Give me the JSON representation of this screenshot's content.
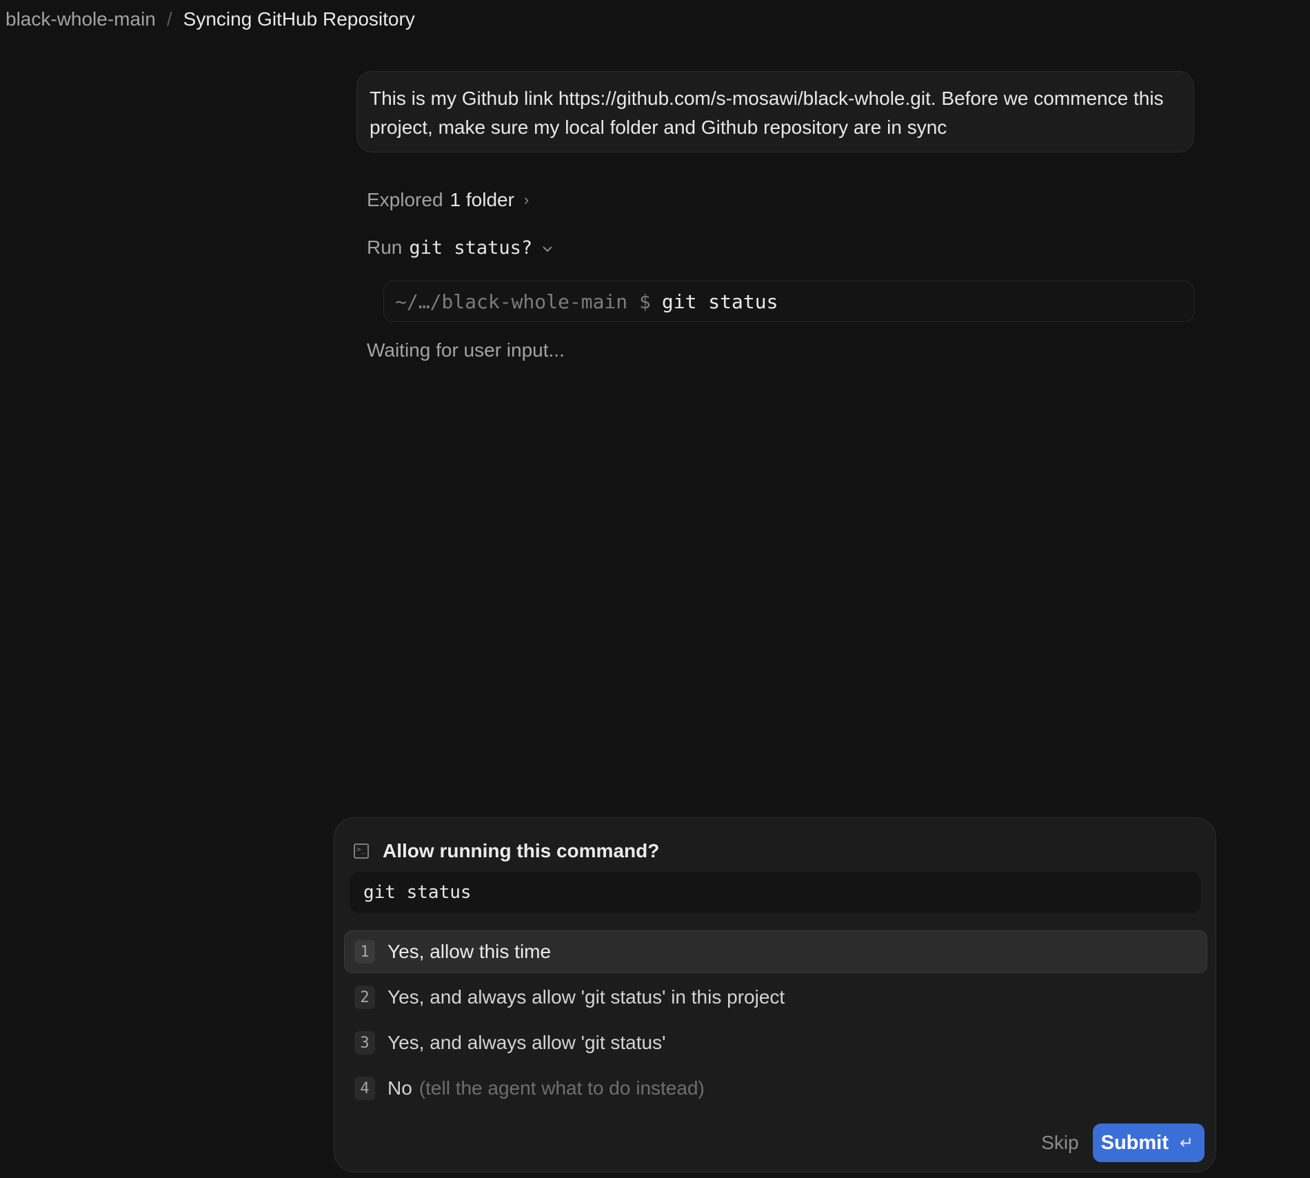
{
  "breadcrumb": {
    "project": "black-whole-main",
    "separator": "/",
    "title": "Syncing GitHub Repository"
  },
  "user_message": {
    "text": "This is my Github link https://github.com/s-mosawi/black-whole.git. Before we commence this project, make sure my local folder and Github repository are in sync"
  },
  "activity": {
    "explored_label": "Explored",
    "explored_count": "1 folder",
    "run_label": "Run",
    "run_command": "git status?",
    "terminal_prompt": "~/…/black-whole-main $",
    "terminal_command": "git status",
    "waiting_text": "Waiting for user input..."
  },
  "permission": {
    "title": "Allow running this command?",
    "icon": "terminal-icon",
    "command": "git status",
    "options": [
      {
        "num": "1",
        "label": "Yes, allow this time",
        "hint": "",
        "selected": true
      },
      {
        "num": "2",
        "label": "Yes, and always allow 'git status' in this project",
        "hint": ""
      },
      {
        "num": "3",
        "label": "Yes, and always allow 'git status'",
        "hint": ""
      },
      {
        "num": "4",
        "label": "No",
        "hint": "(tell the agent what to do instead)"
      }
    ],
    "skip_label": "Skip",
    "submit_label": "Submit",
    "submit_icon": "↵"
  },
  "colors": {
    "background": "#121212",
    "accent": "#3b6fd8"
  }
}
